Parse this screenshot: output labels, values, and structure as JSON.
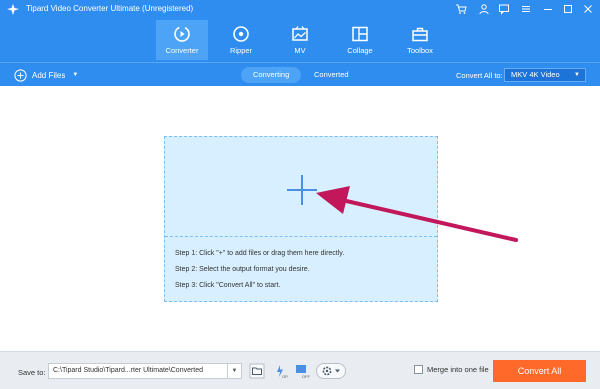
{
  "app": {
    "title": "Tipard Video Converter Ultimate (Unregistered)"
  },
  "window_controls": [
    "cart-icon",
    "account-icon",
    "chat-icon",
    "menu-icon",
    "minimize-icon",
    "maximize-icon",
    "close-icon"
  ],
  "nav": {
    "tabs": [
      {
        "label": "Converter",
        "icon": "converter-icon",
        "active": true
      },
      {
        "label": "Ripper",
        "icon": "ripper-disc-icon",
        "active": false
      },
      {
        "label": "MV",
        "icon": "mv-icon",
        "active": false
      },
      {
        "label": "Collage",
        "icon": "collage-icon",
        "active": false
      },
      {
        "label": "Toolbox",
        "icon": "toolbox-icon",
        "active": false
      }
    ]
  },
  "toolbar": {
    "add_files_label": "Add Files",
    "segments": [
      {
        "label": "Converting",
        "active": true
      },
      {
        "label": "Converted",
        "active": false
      }
    ],
    "convert_all_to_label": "Convert All to:",
    "format_value": "MKV 4K Video"
  },
  "dropzone": {
    "steps": [
      "Step 1: Click \"+\" to add files or drag them here directly.",
      "Step 2: Select the output format you desire.",
      "Step 3: Click \"Convert All\" to start."
    ]
  },
  "footer": {
    "save_to_label": "Save to:",
    "save_path": "C:\\Tipard Studio\\Tipard...rter Ultimate\\Converted",
    "merge_label": "Merge into one file",
    "merge_checked": false,
    "convert_button_label": "Convert All"
  },
  "colors": {
    "header_blue": "#2f8df0",
    "dropzone_fill": "#d8efff",
    "arrow": "#c2185b",
    "convert_button": "#ff6a2b"
  }
}
